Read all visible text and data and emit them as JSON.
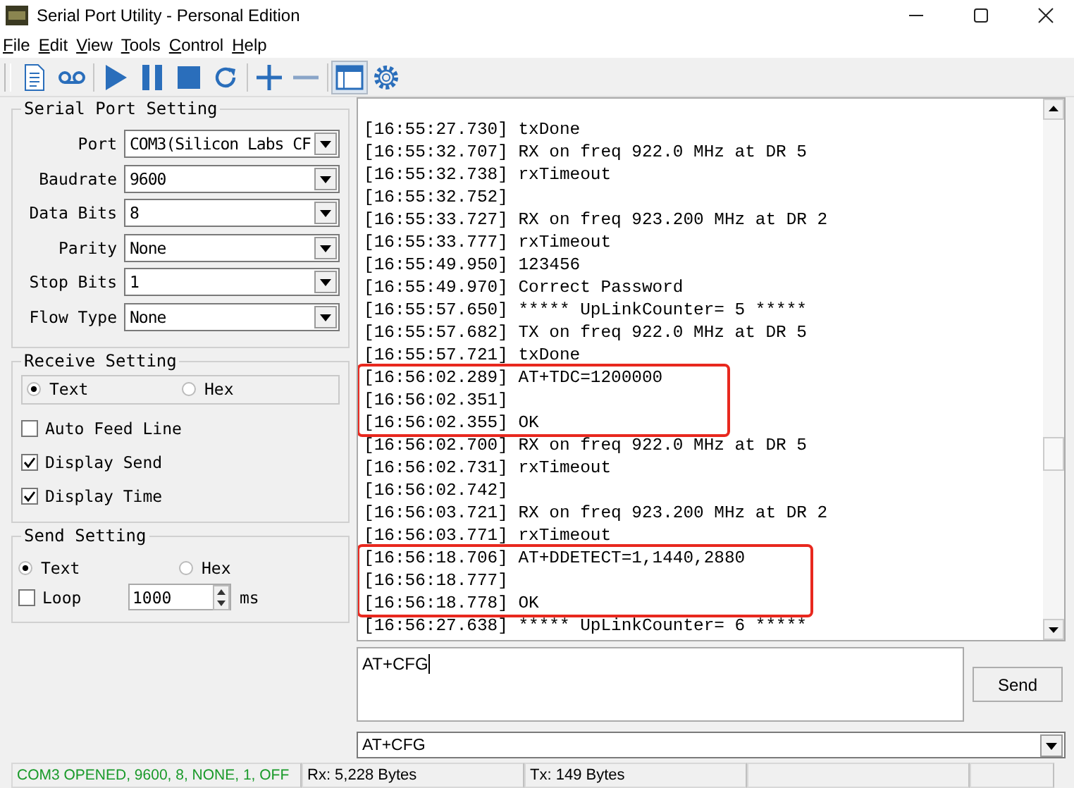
{
  "window": {
    "title": "Serial Port Utility - Personal Edition"
  },
  "menu": [
    "File",
    "Edit",
    "View",
    "Tools",
    "Control",
    "Help"
  ],
  "toolbar": [
    {
      "kind": "document",
      "pressed": false
    },
    {
      "kind": "tape",
      "pressed": false
    },
    {
      "kind": "sep"
    },
    {
      "kind": "play",
      "pressed": false
    },
    {
      "kind": "pause",
      "pressed": false
    },
    {
      "kind": "stop",
      "pressed": false
    },
    {
      "kind": "refresh",
      "pressed": false
    },
    {
      "kind": "sep"
    },
    {
      "kind": "plus",
      "pressed": false
    },
    {
      "kind": "minus",
      "pressed": false
    },
    {
      "kind": "sep"
    },
    {
      "kind": "window",
      "pressed": true
    },
    {
      "kind": "gear",
      "pressed": false
    }
  ],
  "serial_port_setting": {
    "title": "Serial Port Setting",
    "fields": [
      {
        "label": "Port",
        "value": "COM3(Silicon Labs CF"
      },
      {
        "label": "Baudrate",
        "value": "9600"
      },
      {
        "label": "Data Bits",
        "value": "8"
      },
      {
        "label": "Parity",
        "value": "None"
      },
      {
        "label": "Stop Bits",
        "value": "1"
      },
      {
        "label": "Flow Type",
        "value": "None"
      }
    ]
  },
  "receive_setting": {
    "title": "Receive Setting",
    "modes": [
      {
        "label": "Text",
        "selected": true
      },
      {
        "label": "Hex",
        "selected": false
      }
    ],
    "options": [
      {
        "label": "Auto Feed Line",
        "checked": false
      },
      {
        "label": "Display Send",
        "checked": true
      },
      {
        "label": "Display Time",
        "checked": true
      }
    ]
  },
  "send_setting": {
    "title": "Send Setting",
    "modes": [
      {
        "label": "Text",
        "selected": true
      },
      {
        "label": "Hex",
        "selected": false
      }
    ],
    "loop": {
      "label": "Loop",
      "checked": false,
      "interval": "1000",
      "unit": "ms"
    }
  },
  "log": [
    {
      "highlighted": false,
      "lines": [
        "[16:55:27.730] txDone",
        "[16:55:32.707] RX on freq 922.0 MHz at DR 5",
        "[16:55:32.738] rxTimeout",
        "[16:55:32.752]",
        "[16:55:33.727] RX on freq 923.200 MHz at DR 2",
        "[16:55:33.777] rxTimeout",
        "[16:55:49.950] 123456",
        "[16:55:49.970] Correct Password",
        "[16:55:57.650] ***** UpLinkCounter= 5 *****",
        "[16:55:57.682] TX on freq 922.0 MHz at DR 5",
        "[16:55:57.721] txDone"
      ]
    },
    {
      "highlighted": true,
      "lines": [
        "[16:56:02.289] AT+TDC=1200000",
        "[16:56:02.351]",
        "[16:56:02.355] OK"
      ]
    },
    {
      "highlighted": false,
      "lines": [
        "[16:56:02.700] RX on freq 922.0 MHz at DR 5",
        "[16:56:02.731] rxTimeout",
        "[16:56:02.742]",
        "[16:56:03.721] RX on freq 923.200 MHz at DR 2",
        "[16:56:03.771] rxTimeout"
      ]
    },
    {
      "highlighted": true,
      "lines": [
        "[16:56:18.706] AT+DDETECT=1,1440,2880",
        "[16:56:18.777]",
        "[16:56:18.778] OK"
      ]
    },
    {
      "highlighted": false,
      "lines": [
        "[16:56:27.638] ***** UpLinkCounter= 6 *****"
      ]
    }
  ],
  "send": {
    "value": "AT+CFG",
    "button": "Send",
    "history": "AT+CFG"
  },
  "status_bar": [
    {
      "kind": "connection",
      "text": "COM3 OPENED, 9600, 8, NONE, 1, OFF"
    },
    {
      "kind": "counter",
      "text": "Rx: 5,228 Bytes"
    },
    {
      "kind": "counter",
      "text": "Tx: 149 Bytes"
    },
    {
      "kind": "empty"
    },
    {
      "kind": "empty"
    }
  ]
}
